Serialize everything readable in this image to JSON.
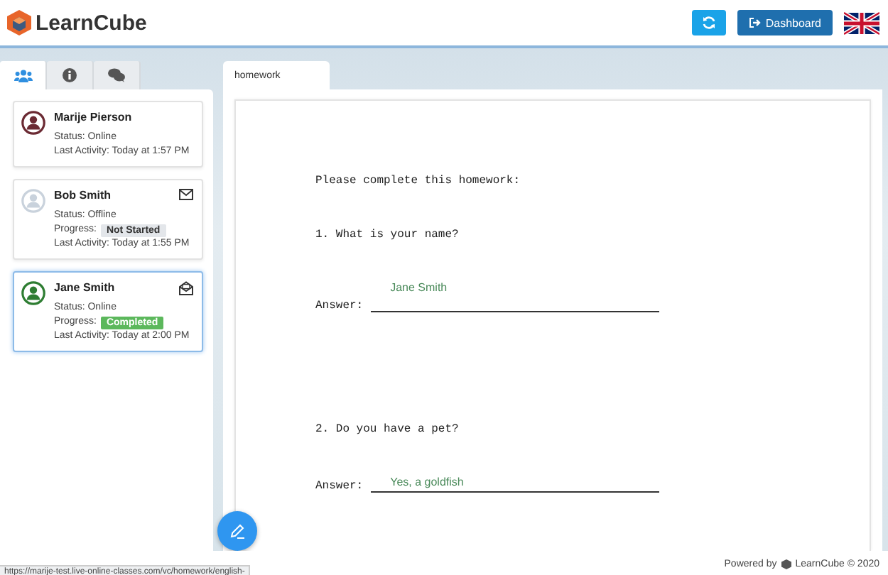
{
  "header": {
    "logo": "LearnCube",
    "dashboard_button": "Dashboard"
  },
  "sidebar": {
    "tabs": [
      {
        "selected": true
      },
      {
        "selected": false
      },
      {
        "selected": false
      }
    ],
    "students": [
      {
        "kind": "plain",
        "name": "Marije Pierson",
        "status": "Status: Online",
        "last_activity": "Last Activity: Today at 1:57 PM",
        "color": "#6b2a33",
        "selected": false
      },
      {
        "kind": "mail",
        "name": "Bob Smith",
        "status": "Status: Offline",
        "progress_label": "Progress:",
        "progress": {
          "label": "Not Started",
          "color": "#e3e6ea"
        },
        "last_activity": "Last Activity: Today at 1:55 PM",
        "color": "#c9d2dc",
        "selected": false
      },
      {
        "kind": "opened",
        "name": "Jane Smith",
        "status": "Status: Online",
        "progress_label": "Progress:",
        "progress": {
          "label": "Completed",
          "color": "#5cb85c"
        },
        "last_activity": "Last Activity: Today at 2:00 PM",
        "color": "#2e7d32",
        "selected": true
      }
    ]
  },
  "document": {
    "tab": "homework",
    "intro": "Please complete this homework:",
    "questions": [
      {
        "question": "1. What is your name?",
        "label": "Answer:",
        "answer": "Jane Smith"
      },
      {
        "question": "2. Do you have a pet?",
        "label": "Answer:",
        "answer": "Yes, a goldfish"
      }
    ]
  },
  "footer": {
    "powered_by": "Powered by",
    "brand": "LearnCube © 2020"
  },
  "status_url": "https://marije-test.live-online-classes.com/vc/homework/english-"
}
